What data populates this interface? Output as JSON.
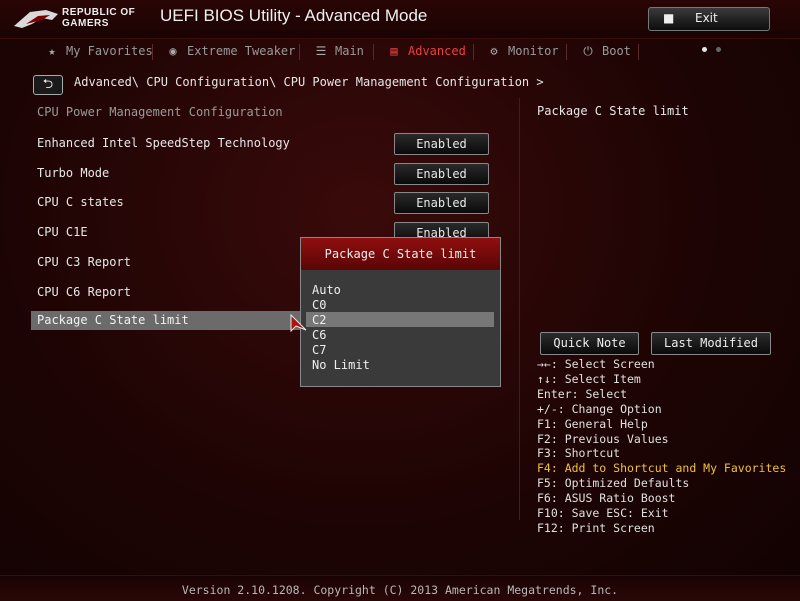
{
  "header": {
    "logo_text": [
      "REPUBLIC OF",
      "GAMERS"
    ],
    "title": "UEFI BIOS Utility - Advanced Mode",
    "exit_label": "Exit"
  },
  "tabs": [
    {
      "label": "My Favorites",
      "icon": "star-icon",
      "active": false
    },
    {
      "label": "Extreme Tweaker",
      "icon": "tweaker-icon",
      "active": false
    },
    {
      "label": "Main",
      "icon": "list-icon",
      "active": false
    },
    {
      "label": "Advanced",
      "icon": "advanced-icon",
      "active": true
    },
    {
      "label": "Monitor",
      "icon": "monitor-icon",
      "active": false
    },
    {
      "label": "Boot",
      "icon": "power-icon",
      "active": false
    }
  ],
  "breadcrumb": "Advanced\\ CPU Configuration\\ CPU Power Management Configuration >",
  "section_title": "CPU Power Management Configuration",
  "settings": [
    {
      "label": "Enhanced Intel SpeedStep Technology",
      "value": "Enabled"
    },
    {
      "label": "Turbo Mode",
      "value": "Enabled"
    },
    {
      "label": "CPU C states",
      "value": "Enabled"
    },
    {
      "label": "CPU C1E",
      "value": "Enabled"
    },
    {
      "label": "CPU C3 Report",
      "value": ""
    },
    {
      "label": "CPU C6 Report",
      "value": ""
    },
    {
      "label": "Package C State limit",
      "value": ""
    }
  ],
  "popup": {
    "title": "Package C State limit",
    "options": [
      "Auto",
      "C0",
      "C2",
      "C6",
      "C7",
      "No Limit"
    ],
    "selected": "C2"
  },
  "help": {
    "title": "Package C State limit",
    "quick_note": "Quick Note",
    "last_modified": "Last Modified",
    "keys": [
      "→←: Select Screen",
      "↑↓: Select Item",
      "Enter: Select",
      "+/-: Change Option",
      "F1: General Help",
      "F2: Previous Values",
      "F3: Shortcut",
      "F4: Add to Shortcut and My Favorites",
      "F5: Optimized Defaults",
      "F6: ASUS Ratio Boost",
      "F10: Save  ESC: Exit",
      "F12: Print Screen"
    ],
    "highlight_index": 7
  },
  "footer": "Version 2.10.1208. Copyright (C) 2013 American Megatrends, Inc.",
  "colors": {
    "accent": "#e84040",
    "highlight_text": "#f1c232"
  }
}
